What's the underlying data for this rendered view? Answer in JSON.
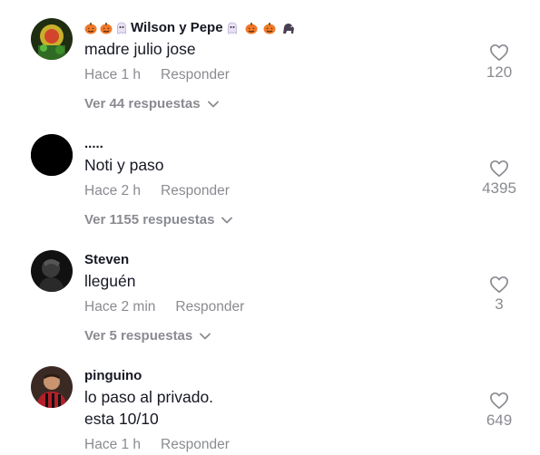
{
  "comments": [
    {
      "username": "Wilson y Pepe",
      "text": "madre julio jose",
      "time": "Hace 1 h",
      "reply_label": "Responder",
      "replies_label": "Ver 44 respuestas",
      "likes": "120"
    },
    {
      "username": ".....",
      "text": "Noti y paso",
      "time": "Hace 2 h",
      "reply_label": "Responder",
      "replies_label": "Ver 1155 respuestas",
      "likes": "4395"
    },
    {
      "username": "Steven",
      "text": "lleguén",
      "time": "Hace 2 min",
      "reply_label": "Responder",
      "replies_label": "Ver 5 respuestas",
      "likes": "3"
    },
    {
      "username": "pinguino",
      "text_line1": "lo paso al privado.",
      "text_line2": "esta 10/10",
      "time": "Hace 1 h",
      "reply_label": "Responder",
      "likes": "649"
    }
  ],
  "icons": {
    "username_emoji_1": "pumpkin-icon",
    "username_emoji_2": "pumpkin-icon",
    "username_emoji_3": "ghost-icon",
    "username_emoji_4": "ghost-icon",
    "username_emoji_5": "pumpkin-icon",
    "username_emoji_6": "pumpkin-icon",
    "username_emoji_7": "gorilla-icon",
    "like": "heart-outline-icon",
    "expand": "chevron-down-icon"
  },
  "colors": {
    "text": "#161823",
    "secondary": "#8a8b91",
    "background": "#ffffff"
  }
}
